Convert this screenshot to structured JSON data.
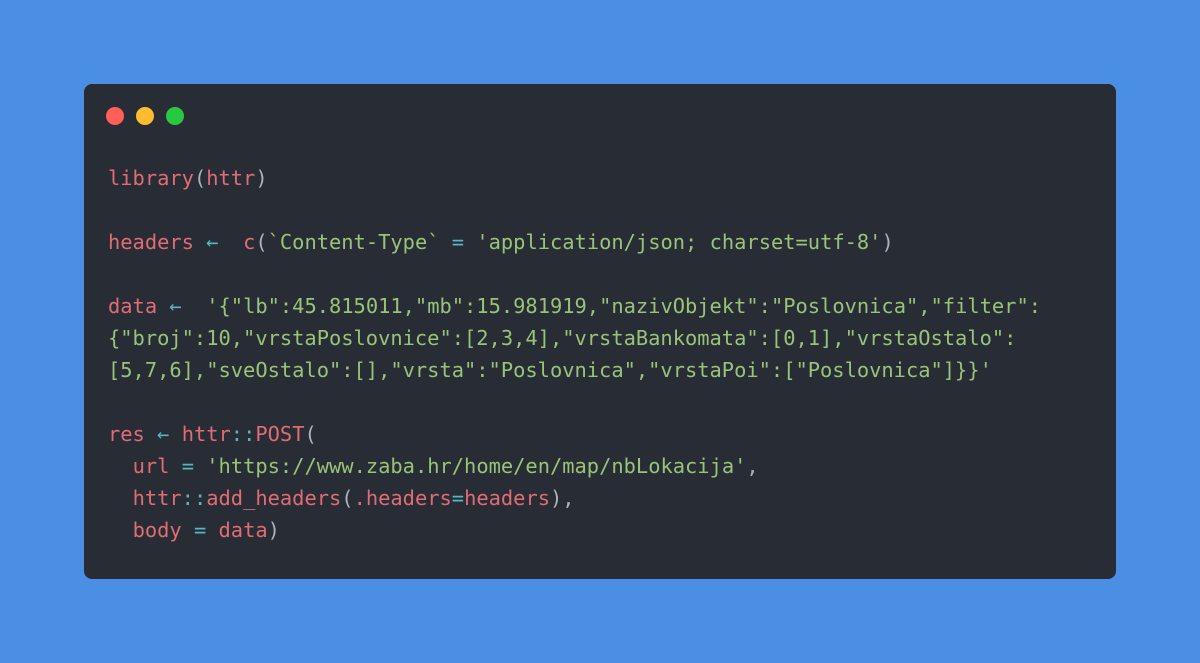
{
  "window": {
    "controls": {
      "close_color": "#ff5f57",
      "minimize_color": "#febc2e",
      "maximize_color": "#28c840"
    },
    "background": "#282c34"
  },
  "page": {
    "background": "#4a8fe3"
  },
  "syntax_colors": {
    "identifier": "#e06c75",
    "operator": "#56b6c2",
    "string": "#98c379",
    "punctuation": "#abb2bf"
  },
  "code": {
    "language": "R",
    "lines": [
      [
        {
          "t": "red",
          "text": "library"
        },
        {
          "t": "pun",
          "text": "("
        },
        {
          "t": "red",
          "text": "httr"
        },
        {
          "t": "pun",
          "text": ")"
        }
      ],
      [],
      [
        {
          "t": "red",
          "text": "headers"
        },
        {
          "t": "pun",
          "text": " "
        },
        {
          "t": "op",
          "text": "←"
        },
        {
          "t": "pun",
          "text": "  "
        },
        {
          "t": "red",
          "text": "c"
        },
        {
          "t": "pun",
          "text": "("
        },
        {
          "t": "str",
          "text": "`Content-Type`"
        },
        {
          "t": "pun",
          "text": " "
        },
        {
          "t": "op",
          "text": "="
        },
        {
          "t": "pun",
          "text": " "
        },
        {
          "t": "str",
          "text": "'application/json; charset=utf-8'"
        },
        {
          "t": "pun",
          "text": ")"
        }
      ],
      [],
      [
        {
          "t": "red",
          "text": "data"
        },
        {
          "t": "pun",
          "text": " "
        },
        {
          "t": "op",
          "text": "←"
        },
        {
          "t": "pun",
          "text": "  "
        },
        {
          "t": "str",
          "text": "'{\"lb\":45.815011,\"mb\":15.981919,\"nazivObjekt\":\"Poslovnica\",\"filter\":"
        }
      ],
      [
        {
          "t": "str",
          "text": "{\"broj\":10,\"vrstaPoslovnice\":[2,3,4],\"vrstaBankomata\":[0,1],\"vrstaOstalo\":"
        }
      ],
      [
        {
          "t": "str",
          "text": "[5,7,6],\"sveOstalo\":[],\"vrsta\":\"Poslovnica\",\"vrstaPoi\":[\"Poslovnica\"]}}'"
        }
      ],
      [],
      [
        {
          "t": "red",
          "text": "res"
        },
        {
          "t": "pun",
          "text": " "
        },
        {
          "t": "op",
          "text": "←"
        },
        {
          "t": "pun",
          "text": " "
        },
        {
          "t": "red",
          "text": "httr"
        },
        {
          "t": "op",
          "text": "::"
        },
        {
          "t": "red",
          "text": "POST"
        },
        {
          "t": "pun",
          "text": "("
        }
      ],
      [
        {
          "t": "pun",
          "text": "  "
        },
        {
          "t": "red",
          "text": "url"
        },
        {
          "t": "pun",
          "text": " "
        },
        {
          "t": "op",
          "text": "="
        },
        {
          "t": "pun",
          "text": " "
        },
        {
          "t": "str",
          "text": "'https://www.zaba.hr/home/en/map/nbLokacija'"
        },
        {
          "t": "pun",
          "text": ","
        }
      ],
      [
        {
          "t": "pun",
          "text": "  "
        },
        {
          "t": "red",
          "text": "httr"
        },
        {
          "t": "op",
          "text": "::"
        },
        {
          "t": "red",
          "text": "add_headers"
        },
        {
          "t": "pun",
          "text": "("
        },
        {
          "t": "red",
          "text": ".headers"
        },
        {
          "t": "op",
          "text": "="
        },
        {
          "t": "red",
          "text": "headers"
        },
        {
          "t": "pun",
          "text": "),"
        }
      ],
      [
        {
          "t": "pun",
          "text": "  "
        },
        {
          "t": "red",
          "text": "body"
        },
        {
          "t": "pun",
          "text": " "
        },
        {
          "t": "op",
          "text": "="
        },
        {
          "t": "pun",
          "text": " "
        },
        {
          "t": "red",
          "text": "data"
        },
        {
          "t": "pun",
          "text": ")"
        }
      ]
    ]
  }
}
